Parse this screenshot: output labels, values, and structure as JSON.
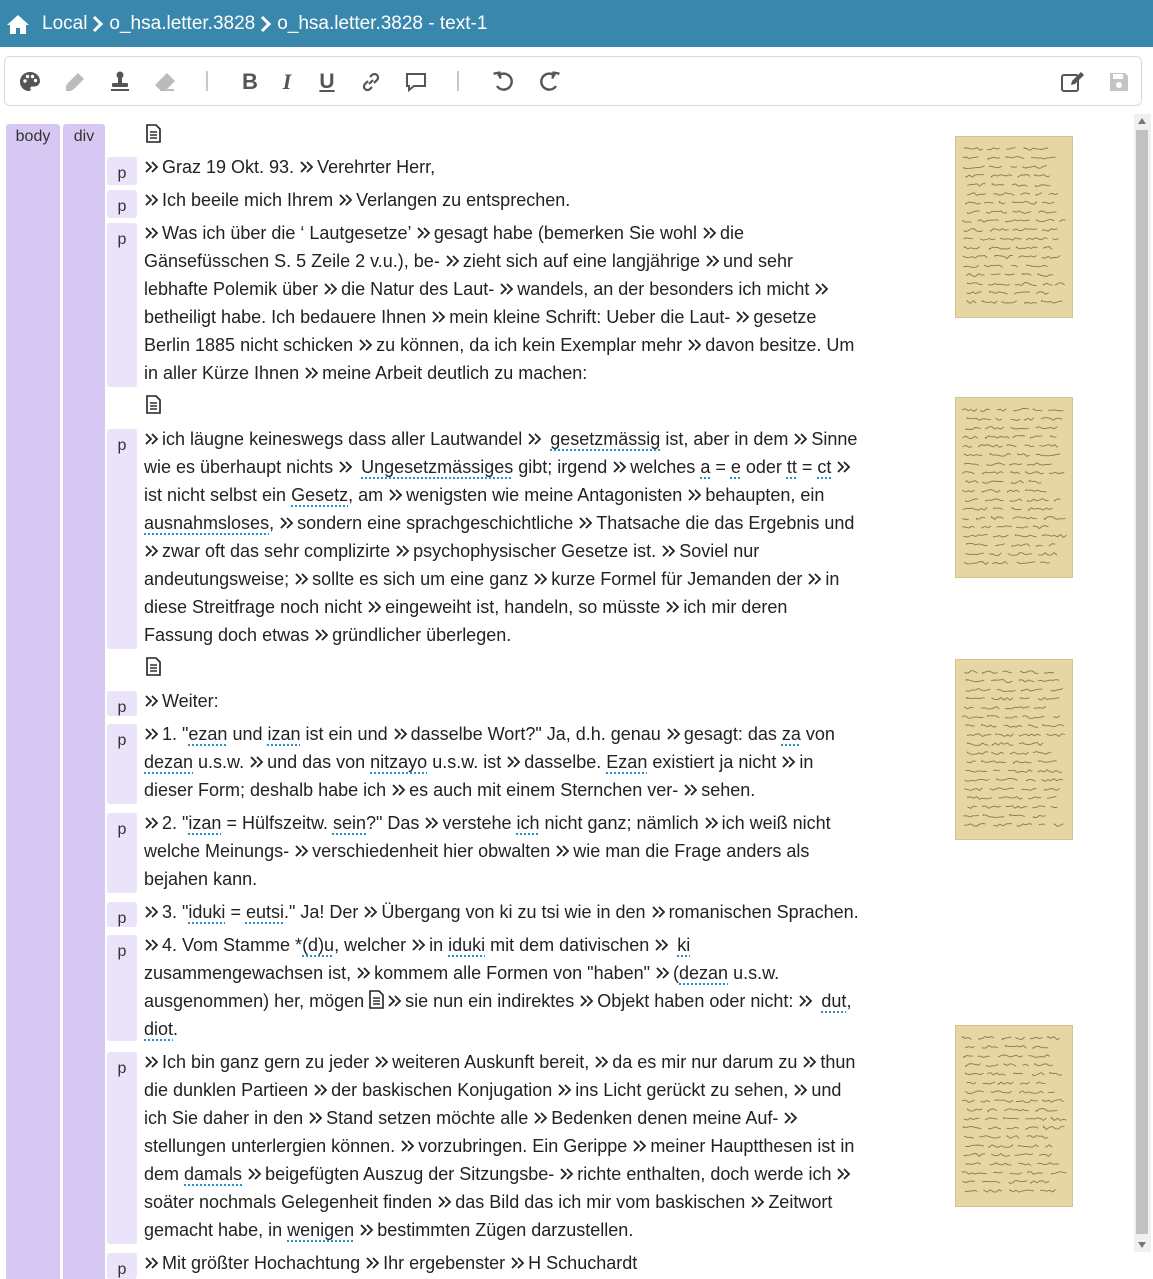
{
  "header": {
    "crumbs": [
      "Local",
      "o_hsa.letter.3828",
      "o_hsa.letter.3828 - text-1"
    ]
  },
  "toolbar": {
    "icons": [
      "palette-icon",
      "highlighter-icon",
      "stamp-icon",
      "eraser-icon",
      "bold-icon",
      "italic-icon",
      "underline-icon",
      "link-icon",
      "comment-icon",
      "undo-icon",
      "redo-icon",
      "edit-icon",
      "save-icon"
    ],
    "bold": "B",
    "italic": "I",
    "underline": "U"
  },
  "tags": {
    "body": "body",
    "div": "div",
    "p": "p"
  },
  "colors": {
    "header": "#3a87ad",
    "tag_column": "#d6c8f3",
    "p_box": "#ebe3fa",
    "link_underline": "#2a8fd0"
  },
  "lines": [
    [
      {
        "t": "Graz 19 Okt. 93. "
      },
      {
        "m": 1
      },
      {
        "t": "Verehrter Herr,"
      }
    ],
    [
      {
        "t": "Ich beeile mich Ihrem "
      },
      {
        "m": 1
      },
      {
        "t": "Verlangen zu entsprechen."
      }
    ],
    [
      {
        "t": "Was ich über die ‘ Lautgesetze’ "
      },
      {
        "m": 1
      },
      {
        "t": "gesagt habe (bemerken Sie wohl "
      },
      {
        "m": 1
      },
      {
        "t": "die"
      }
    ],
    [
      {
        "t": "Gänsefüsschen S. 5 Zeile 2 v.u.), be- "
      },
      {
        "m": 1
      },
      {
        "t": "zieht sich auf eine langjährige "
      },
      {
        "m": 1
      },
      {
        "t": "und sehr"
      }
    ],
    [
      {
        "t": "lebhafte Polemik über "
      },
      {
        "m": 1
      },
      {
        "t": "die Natur des Laut- "
      },
      {
        "m": 1
      },
      {
        "t": "wandels, an der besonders ich micht "
      },
      {
        "m": 1
      }
    ],
    [
      {
        "t": "betheiligt habe. Ich bedauere Ihnen "
      },
      {
        "m": 1
      },
      {
        "t": "mein kleine Schrift: Ueber die Laut- "
      },
      {
        "m": 1
      },
      {
        "t": "gesetze"
      }
    ],
    [
      {
        "t": "Berlin 1885 nicht schicken "
      },
      {
        "m": 1
      },
      {
        "t": "zu können, da ich kein Exemplar mehr "
      },
      {
        "m": 1
      },
      {
        "t": "davon besitze. Um"
      }
    ],
    [
      {
        "t": "in aller Kürze Ihnen "
      },
      {
        "m": 1
      },
      {
        "t": "meine Arbeit deutlich zu machen:"
      }
    ],
    [
      {
        "t": "ich läugne keineswegs dass aller Lautwandel "
      },
      {
        "m": 1
      },
      {
        "t": " "
      },
      {
        "l": "gesetzmässig"
      },
      {
        "t": " ist, aber in dem "
      },
      {
        "m": 1
      },
      {
        "t": "Sinne"
      }
    ],
    [
      {
        "t": "wie es überhaupt nichts "
      },
      {
        "m": 1
      },
      {
        "t": " "
      },
      {
        "l": "Ungesetzmässiges"
      },
      {
        "t": " gibt; irgend "
      },
      {
        "m": 1
      },
      {
        "t": "welches "
      },
      {
        "l": "a"
      },
      {
        "t": " = "
      },
      {
        "l": "e"
      },
      {
        "t": " oder "
      },
      {
        "l": "tt"
      },
      {
        "t": " = "
      },
      {
        "l": "ct"
      },
      {
        "t": " "
      },
      {
        "m": 1
      }
    ],
    [
      {
        "t": "ist nicht selbst ein "
      },
      {
        "l": "Gesetz"
      },
      {
        "t": ", am "
      },
      {
        "m": 1
      },
      {
        "t": "wenigsten wie meine Antagonisten "
      },
      {
        "m": 1
      },
      {
        "t": "behaupten, ein"
      }
    ],
    [
      {
        "l": "ausnahmsloses"
      },
      {
        "t": ", "
      },
      {
        "m": 1
      },
      {
        "t": "sondern eine sprachgeschichtliche "
      },
      {
        "m": 1
      },
      {
        "t": "Thatsache die das Ergebnis und"
      }
    ],
    [
      {
        "m": 1
      },
      {
        "t": "zwar oft das sehr complizirte "
      },
      {
        "m": 1
      },
      {
        "t": "psychophysischer Gesetze ist. "
      },
      {
        "m": 1
      },
      {
        "t": "Soviel nur"
      }
    ],
    [
      {
        "t": "andeutungsweise; "
      },
      {
        "m": 1
      },
      {
        "t": "sollte es sich um eine ganz "
      },
      {
        "m": 1
      },
      {
        "t": "kurze Formel für Jemanden der "
      },
      {
        "m": 1
      },
      {
        "t": "in"
      }
    ],
    [
      {
        "t": "diese Streitfrage noch nicht "
      },
      {
        "m": 1
      },
      {
        "t": "eingeweiht ist, handeln, so müsste "
      },
      {
        "m": 1
      },
      {
        "t": "ich mir deren"
      }
    ],
    [
      {
        "t": "Fassung doch etwas "
      },
      {
        "m": 1
      },
      {
        "t": "gründlicher überlegen."
      }
    ],
    [
      {
        "t": "Weiter:"
      }
    ],
    [
      {
        "t": "1. \""
      },
      {
        "l": "ezan"
      },
      {
        "t": " und "
      },
      {
        "l": "izan"
      },
      {
        "t": " ist ein und "
      },
      {
        "m": 1
      },
      {
        "t": "dasselbe Wort?\" Ja, d.h. genau "
      },
      {
        "m": 1
      },
      {
        "t": "gesagt: das "
      },
      {
        "l": "za"
      },
      {
        "t": " von"
      }
    ],
    [
      {
        "l": "dezan"
      },
      {
        "t": " u.s.w. "
      },
      {
        "m": 1
      },
      {
        "t": "und das von "
      },
      {
        "l": "nitzayo"
      },
      {
        "t": " u.s.w. ist "
      },
      {
        "m": 1
      },
      {
        "t": "dasselbe. "
      },
      {
        "l": "Ezan"
      },
      {
        "t": " existiert ja nicht "
      },
      {
        "m": 1
      },
      {
        "t": "in"
      }
    ],
    [
      {
        "t": "dieser Form; deshalb habe ich "
      },
      {
        "m": 1
      },
      {
        "t": "es auch mit einem Sternchen ver- "
      },
      {
        "m": 1
      },
      {
        "t": "sehen."
      }
    ],
    [
      {
        "t": "2. \""
      },
      {
        "l": "izan"
      },
      {
        "t": " = Hülfszeitw. "
      },
      {
        "l": "sein"
      },
      {
        "t": "?\" Das "
      },
      {
        "m": 1
      },
      {
        "t": "verstehe "
      },
      {
        "l": "ich"
      },
      {
        "t": " nicht ganz; nämlich "
      },
      {
        "m": 1
      },
      {
        "t": "ich weiß nicht"
      }
    ],
    [
      {
        "t": "welche Meinungs- "
      },
      {
        "m": 1
      },
      {
        "t": "verschiedenheit hier obwalten "
      },
      {
        "m": 1
      },
      {
        "t": "wie man die Frage anders als"
      }
    ],
    [
      {
        "t": "bejahen kann."
      }
    ],
    [
      {
        "t": "3. \""
      },
      {
        "l": "iduki"
      },
      {
        "t": " = "
      },
      {
        "l": "eutsi"
      },
      {
        "t": ".\" Ja! Der "
      },
      {
        "m": 1
      },
      {
        "t": "Übergang von ki zu tsi wie in den "
      },
      {
        "m": 1
      },
      {
        "t": "romanischen Sprachen."
      }
    ],
    [
      {
        "t": "4. Vom Stamme *"
      },
      {
        "l": "(d)u"
      },
      {
        "t": ", welcher "
      },
      {
        "m": 1
      },
      {
        "t": "in "
      },
      {
        "l": "iduki"
      },
      {
        "t": " mit dem dativischen "
      },
      {
        "m": 1
      },
      {
        "t": " "
      },
      {
        "l": "ki"
      }
    ],
    [
      {
        "t": "zusammengewachsen ist, "
      },
      {
        "m": 1
      },
      {
        "t": "kommem alle Formen von \"haben\" "
      },
      {
        "m": 1
      },
      {
        "t": "("
      },
      {
        "l": "dezan"
      },
      {
        "t": " u.s.w."
      }
    ],
    [
      {
        "t": "ausgenommen) her, mögen "
      },
      {
        "d": 1
      },
      {
        "m": 1
      },
      {
        "t": "sie nun ein indirektes "
      },
      {
        "m": 1
      },
      {
        "t": "Objekt haben oder nicht: "
      },
      {
        "m": 1
      },
      {
        "t": " "
      },
      {
        "l": "dut"
      },
      {
        "t": ","
      }
    ],
    [
      {
        "l": "diot"
      },
      {
        "t": "."
      }
    ],
    [
      {
        "t": "Ich bin ganz gern zu jeder "
      },
      {
        "m": 1
      },
      {
        "t": "weiteren Auskunft bereit, "
      },
      {
        "m": 1
      },
      {
        "t": "da es mir nur darum zu "
      },
      {
        "m": 1
      },
      {
        "t": "thun"
      }
    ],
    [
      {
        "t": "die dunklen Partieen "
      },
      {
        "m": 1
      },
      {
        "t": "der baskischen Konjugation "
      },
      {
        "m": 1
      },
      {
        "t": "ins Licht gerückt zu sehen, "
      },
      {
        "m": 1
      },
      {
        "t": "und"
      }
    ],
    [
      {
        "t": "ich Sie daher in den "
      },
      {
        "m": 1
      },
      {
        "t": "Stand setzen möchte alle "
      },
      {
        "m": 1
      },
      {
        "t": "Bedenken denen meine Auf- "
      },
      {
        "m": 1
      }
    ],
    [
      {
        "t": "stellungen unterlergien können. "
      },
      {
        "m": 1
      },
      {
        "t": "vorzubringen. Ein Gerippe "
      },
      {
        "m": 1
      },
      {
        "t": "meiner Hauptthesen ist in"
      }
    ],
    [
      {
        "t": "dem "
      },
      {
        "l": "damals"
      },
      {
        "t": " "
      },
      {
        "m": 1
      },
      {
        "t": "beigefügten Auszug der Sitzungsbe- "
      },
      {
        "m": 1
      },
      {
        "t": "richte enthalten, doch werde ich "
      },
      {
        "m": 1
      }
    ],
    [
      {
        "t": "soäter nochmals Gelegenheit finden "
      },
      {
        "m": 1
      },
      {
        "t": "das Bild das ich mir vom baskischen "
      },
      {
        "m": 1
      },
      {
        "t": "Zeitwort"
      }
    ],
    [
      {
        "t": "gemacht habe, in "
      },
      {
        "l": "wenigen"
      },
      {
        "t": " "
      },
      {
        "m": 1
      },
      {
        "t": "bestimmten Zügen darzustellen."
      }
    ],
    [
      {
        "t": "Mit größter Hochachtung "
      },
      {
        "m": 1
      },
      {
        "t": "Ihr ergebenster "
      },
      {
        "m": 1
      },
      {
        "t": "H Schuchardt"
      }
    ]
  ],
  "line_lead_marker": [
    true,
    true,
    true,
    false,
    false,
    false,
    false,
    false,
    true,
    false,
    false,
    false,
    false,
    false,
    false,
    false,
    true,
    true,
    false,
    false,
    true,
    false,
    false,
    true,
    true,
    false,
    false,
    false,
    true,
    false,
    false,
    false,
    false,
    false,
    false,
    true
  ]
}
